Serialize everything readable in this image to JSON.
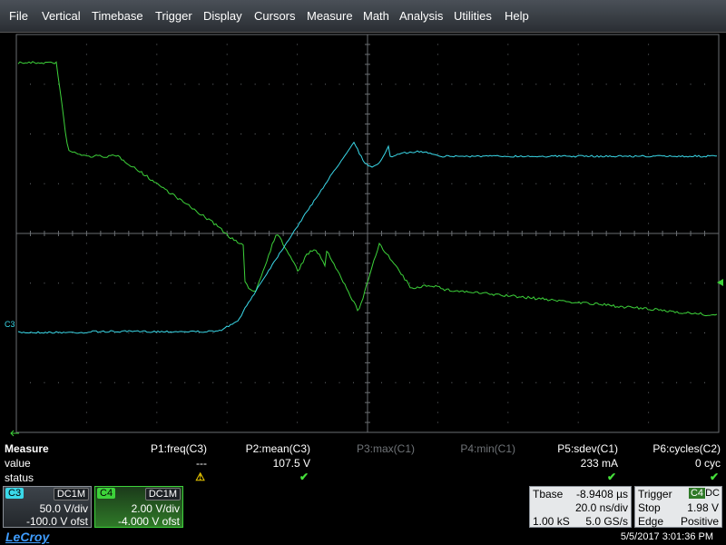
{
  "menu": {
    "items": [
      "File",
      "Vertical",
      "Timebase",
      "Trigger",
      "Display",
      "Cursors",
      "Measure",
      "Math",
      "Analysis",
      "Utilities",
      "Help"
    ]
  },
  "colors": {
    "c3": "#3ad8e8",
    "c4": "#3dd23a",
    "grid": "#6a6e72",
    "ok": "#45e03a",
    "warn": "#e8c600"
  },
  "markers": {
    "c3_label": "C3",
    "trigger_level_icon": "triangle-left-icon",
    "time_origin_icon": "arrow-left-icon"
  },
  "measure": {
    "title": "Measure",
    "row_labels": [
      "value",
      "status"
    ],
    "params": [
      {
        "name": "P1:freq(C3)",
        "value": "---",
        "status": "warn",
        "active": true
      },
      {
        "name": "P2:mean(C3)",
        "value": "107.5 V",
        "status": "ok",
        "active": true
      },
      {
        "name": "P3:max(C1)",
        "value": "",
        "status": "",
        "active": false
      },
      {
        "name": "P4:min(C1)",
        "value": "",
        "status": "",
        "active": false
      },
      {
        "name": "P5:sdev(C1)",
        "value": "233 mA",
        "status": "ok",
        "active": true
      },
      {
        "name": "P6:cycles(C2)",
        "value": "0 cyc",
        "status": "ok",
        "active": true
      }
    ],
    "ok_glyph": "✔",
    "warn_glyph": "⚠"
  },
  "channels": {
    "c3": {
      "label": "C3",
      "coupling": "DC1M",
      "scale": "50.0 V/div",
      "offset": "-100.0 V ofst"
    },
    "c4": {
      "label": "C4",
      "coupling": "DC1M",
      "scale": "2.00 V/div",
      "offset": "-4.000 V ofst"
    }
  },
  "timebase": {
    "label": "Tbase",
    "delay": "-8.9408 µs",
    "scale": "20.0 ns/div",
    "samples": "1.00 kS",
    "rate": "5.0 GS/s"
  },
  "trigger": {
    "label": "Trigger",
    "source": "C4",
    "coupling": "DC",
    "mode": "Stop",
    "level": "1.98 V",
    "type": "Edge",
    "slope": "Positive"
  },
  "brand": "LeCroy",
  "datetime": "5/5/2017 3:01:36 PM"
}
